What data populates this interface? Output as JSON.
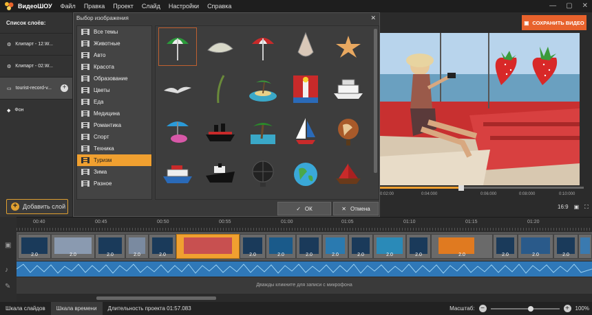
{
  "app": {
    "title": "ВидеоШОУ"
  },
  "menu": [
    "Файл",
    "Правка",
    "Проект",
    "Слайд",
    "Настройки",
    "Справка"
  ],
  "layers_panel": {
    "title": "Список слоёв:",
    "items": [
      {
        "label": "Клипарт - 12.W...",
        "icon": "gear-icon"
      },
      {
        "label": "Клипарт - 02.W...",
        "icon": "gear-icon"
      },
      {
        "label": "tourist-record-v...",
        "icon": "video-icon"
      },
      {
        "label": "Фон",
        "icon": "paint-bucket-icon"
      }
    ],
    "add_layer": "Добавить слой"
  },
  "dialog": {
    "title": "Выбор изображения",
    "categories": [
      "Все темы",
      "Животные",
      "Авто",
      "Красота",
      "Образование",
      "Цветы",
      "Еда",
      "Медицина",
      "Романтика",
      "Спорт",
      "Техника",
      "Туризм",
      "Зима",
      "Разное"
    ],
    "selected_category": "Туризм",
    "ok": "ОК",
    "cancel": "Отмена"
  },
  "save_button": "СОХРАНИТЬ ВИДЕО",
  "player": {
    "times": [
      "0:02:00",
      "0:04:000",
      "0:06:000",
      "0:08:000",
      "0:10:000"
    ],
    "aspect": "16:9"
  },
  "timeline": {
    "ticks": [
      "00:40",
      "00:45",
      "00:50",
      "00:55",
      "01:00",
      "01:05",
      "01:10",
      "01:15",
      "01:20"
    ],
    "clip_duration": "2.0",
    "mic_hint": "Дважды кликните для записи с микрофона"
  },
  "bottombar": {
    "tabs": [
      "Шкала слайдов",
      "Шкала времени"
    ],
    "duration": "Длительность проекта 01:57.083",
    "zoom_label": "Масштаб:",
    "zoom_value": "100%"
  },
  "colors": {
    "accent": "#f0a030",
    "save": "#e8622c",
    "wave": "#2f78b8"
  }
}
